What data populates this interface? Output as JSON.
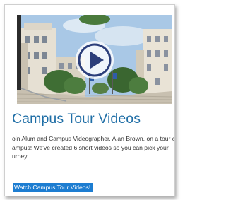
{
  "card": {
    "title": "Campus Tour Videos",
    "description_lines": [
      "oin Alum and Campus Videographer, Alan Brown, on a tour of",
      "ampus! We've created 6 short videos so you can pick your",
      "urney."
    ],
    "cta_label": "Watch Campus Tour Videos!"
  },
  "video": {
    "thumbnail": "campus-buildings-photo",
    "play_icon": "play-icon"
  },
  "colors": {
    "title": "#1f6ea6",
    "link_background": "#1d7dd1",
    "link_text": "#ffffff",
    "play_icon": "#2c3e7a",
    "sky": "#a9c8e6",
    "building": "#e6e0d3",
    "trees": "#3f6e34"
  }
}
